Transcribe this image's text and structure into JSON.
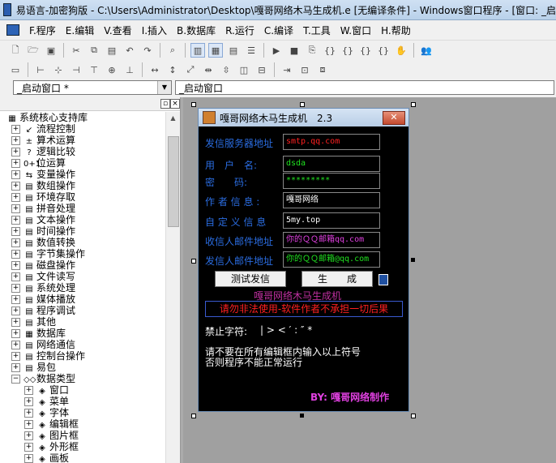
{
  "window": {
    "title": "易语言-加密狗版 - C:\\Users\\Administrator\\Desktop\\嘎哥网络木马生成机.e [无编译条件] - Windows窗口程序 - [窗口: _启"
  },
  "menu": [
    {
      "label": "F.程序"
    },
    {
      "label": "E.编辑"
    },
    {
      "label": "V.查看"
    },
    {
      "label": "I.插入"
    },
    {
      "label": "B.数据库"
    },
    {
      "label": "R.运行"
    },
    {
      "label": "C.编译"
    },
    {
      "label": "T.工具"
    },
    {
      "label": "W.窗口"
    },
    {
      "label": "H.帮助"
    }
  ],
  "combos": {
    "left": "_启动窗口 *",
    "right": "_启动窗口"
  },
  "tree": {
    "root": "系统核心支持库",
    "items": [
      {
        "label": "流程控制",
        "icon": "↙"
      },
      {
        "label": "算术运算",
        "icon": "±"
      },
      {
        "label": "逻辑比较",
        "icon": "?"
      },
      {
        "label": "位运算",
        "icon": "0+1"
      },
      {
        "label": "变量操作",
        "icon": "⇆"
      },
      {
        "label": "数组操作",
        "icon": "▤"
      },
      {
        "label": "环境存取",
        "icon": "▤"
      },
      {
        "label": "拼音处理",
        "icon": "▤"
      },
      {
        "label": "文本操作",
        "icon": "▤"
      },
      {
        "label": "时间操作",
        "icon": "▤"
      },
      {
        "label": "数值转换",
        "icon": "▤"
      },
      {
        "label": "字节集操作",
        "icon": "▤"
      },
      {
        "label": "磁盘操作",
        "icon": "▤"
      },
      {
        "label": "文件读写",
        "icon": "▤"
      },
      {
        "label": "系统处理",
        "icon": "▤"
      },
      {
        "label": "媒体播放",
        "icon": "▤"
      },
      {
        "label": "程序调试",
        "icon": "▤"
      },
      {
        "label": "其他",
        "icon": "▤"
      },
      {
        "label": "数据库",
        "icon": "▦"
      },
      {
        "label": "网络通信",
        "icon": "▤"
      },
      {
        "label": "控制台操作",
        "icon": "▤"
      },
      {
        "label": "易包",
        "icon": "▤"
      },
      {
        "label": "数据类型",
        "icon": "◇◇"
      }
    ],
    "subitems": [
      {
        "label": "窗口"
      },
      {
        "label": "菜单"
      },
      {
        "label": "字体"
      },
      {
        "label": "编辑框"
      },
      {
        "label": "图片框"
      },
      {
        "label": "外形框"
      },
      {
        "label": "画板"
      }
    ]
  },
  "form": {
    "title": "嘎哥网络木马生成机　2.3",
    "close": "✕",
    "fields": [
      {
        "label": "发信服务器地址",
        "value": "smtp.qq.com",
        "color": "#ff2020"
      },
      {
        "label": "用　户　名:",
        "value": "dsda",
        "color": "#20e020"
      },
      {
        "label": "密　　码:",
        "value": "*********",
        "color": "#20e020"
      },
      {
        "label": "作 者 信 息 :",
        "value": "嘎哥网络",
        "color": "#ffffff"
      },
      {
        "label": "自 定 义 信 息",
        "value": "5my.top",
        "color": "#ffffff"
      },
      {
        "label": "收信人邮件地址",
        "value": "你的ＱＱ邮箱qq.com",
        "color": "#e040e0"
      },
      {
        "label": "发信人邮件地址",
        "value": "你的ＱＱ邮箱@qq.com",
        "color": "#20e020"
      }
    ],
    "btn_test": "测试发信",
    "btn_generate": "生　　成",
    "banner_title": "嘎哥网络木马生成机",
    "warning": "请勿非法使用-软件作者不承担一切后果",
    "forbidden_label": "禁止字符:",
    "forbidden_chars": "|  >  <  ′  :  ″  *",
    "note1": "请不要在所有编辑框内输入以上符号",
    "note2": "否则程序不能正常运行",
    "by": "BY: 嘎哥网络制作",
    "colors": {
      "label": "#2a6ce0",
      "warn": "#ff2020",
      "banner": "#c030a0",
      "by": "#e040e0"
    }
  }
}
